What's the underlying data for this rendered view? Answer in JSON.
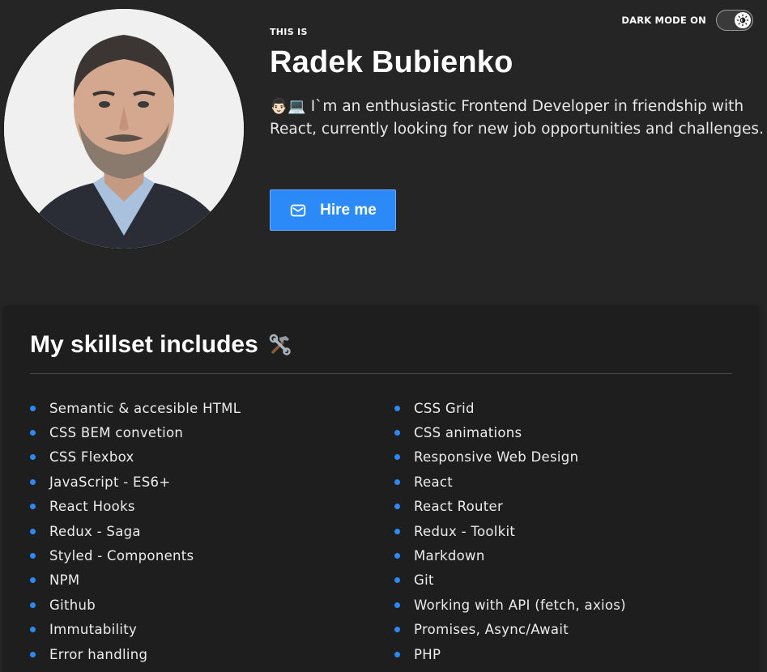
{
  "header": {
    "eyebrow": "THIS IS",
    "name": "Radek Bubienko",
    "bio_emoji": "👨🏻💻",
    "bio": "I`m an enthusiastic Frontend Developer in friendship with React, currently looking for new job opportunities and challenges.",
    "hire_label": "Hire me",
    "hire_icon": "mail-icon"
  },
  "darkmode": {
    "label": "DARK MODE ON",
    "icon": "sun-icon",
    "enabled": true
  },
  "skills": {
    "title": "My skillset includes",
    "title_icon": "tools-icon",
    "left": [
      "Semantic & accesible HTML",
      "CSS BEM convetion",
      "CSS Flexbox",
      "JavaScript - ES6+",
      "React Hooks",
      "Redux - Saga",
      "Styled - Components",
      "NPM",
      "Github",
      "Immutability",
      "Error handling"
    ],
    "right": [
      "CSS Grid",
      "CSS animations",
      "Responsive Web Design",
      "React",
      "React Router",
      "Redux - Toolkit",
      "Markdown",
      "Git",
      "Working with API (fetch, axios)",
      "Promises, Async/Await",
      "PHP"
    ]
  },
  "colors": {
    "background": "#252526",
    "panel": "#1e1e1e",
    "accent": "#2b8af7"
  }
}
